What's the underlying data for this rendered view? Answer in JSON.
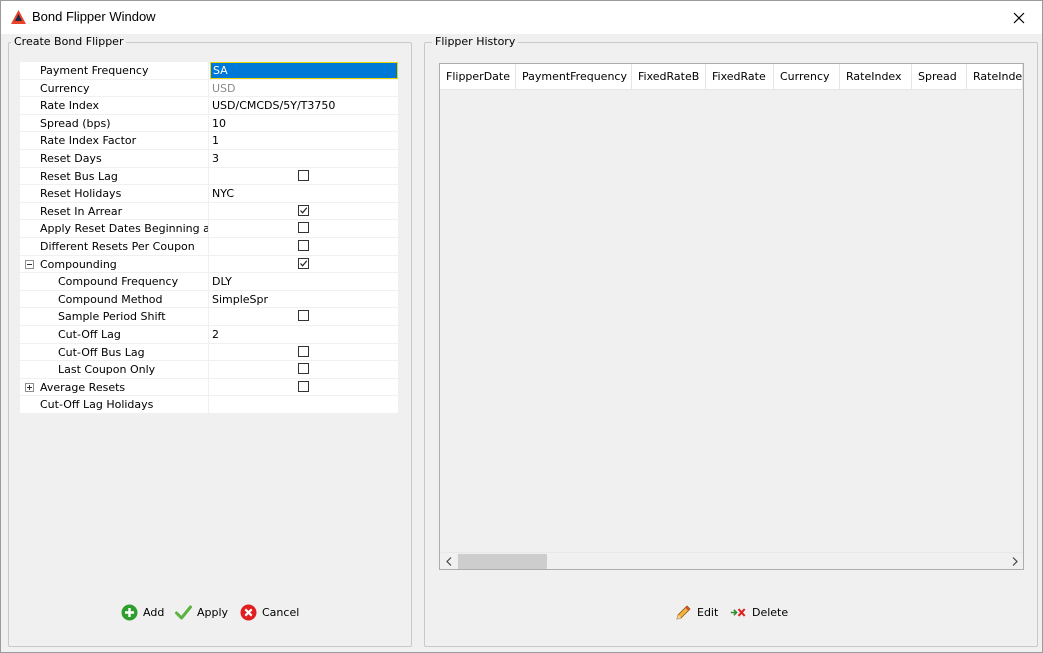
{
  "window": {
    "title": "Bond Flipper Window"
  },
  "create_group": {
    "title": "Create Bond Flipper"
  },
  "history_group": {
    "title": "Flipper History"
  },
  "properties": [
    {
      "label": "Payment Frequency",
      "value": "SA",
      "state": "selected"
    },
    {
      "label": "Currency",
      "value": "USD",
      "state": "disabled"
    },
    {
      "label": "Rate Index",
      "value": "USD/CMCDS/5Y/T3750"
    },
    {
      "label": "Spread (bps)",
      "value": "10"
    },
    {
      "label": "Rate Index Factor",
      "value": "1"
    },
    {
      "label": "Reset Days",
      "value": "3"
    },
    {
      "label": "Reset Bus Lag",
      "checkbox": false
    },
    {
      "label": "Reset Holidays",
      "value": "NYC"
    },
    {
      "label": "Reset In Arrear",
      "checkbox": true
    },
    {
      "label": "Apply Reset Dates Beginning a...",
      "checkbox": false
    },
    {
      "label": "Different Resets Per Coupon",
      "checkbox": false
    },
    {
      "label": "Compounding",
      "checkbox": true,
      "expander": "expanded"
    },
    {
      "label": "Compound Frequency",
      "value": "DLY",
      "indent": true
    },
    {
      "label": "Compound Method",
      "value": "SimpleSpr",
      "indent": true
    },
    {
      "label": "Sample Period Shift",
      "checkbox": false,
      "indent": true
    },
    {
      "label": "Cut-Off Lag",
      "value": "2",
      "indent": true
    },
    {
      "label": "Cut-Off Bus Lag",
      "checkbox": false,
      "indent": true
    },
    {
      "label": "Last Coupon Only",
      "checkbox": false,
      "indent": true
    },
    {
      "label": "Average Resets",
      "checkbox": false,
      "expander": "collapsed"
    },
    {
      "label": "Cut-Off Lag Holidays",
      "value": ""
    }
  ],
  "left_buttons": {
    "add": "Add",
    "apply": "Apply",
    "cancel": "Cancel"
  },
  "history": {
    "columns": [
      "FlipperDate",
      "PaymentFrequency",
      "FixedRateB",
      "FixedRate",
      "Currency",
      "RateIndex",
      "Spread",
      "RateIndex"
    ],
    "scroll_position": 0
  },
  "right_buttons": {
    "edit": "Edit",
    "delete": "Delete"
  },
  "colors": {
    "selection": "#0078d7",
    "window_bg": "#f0f0f0",
    "add_green": "#2e9e2e",
    "cancel_red": "#e02020"
  }
}
